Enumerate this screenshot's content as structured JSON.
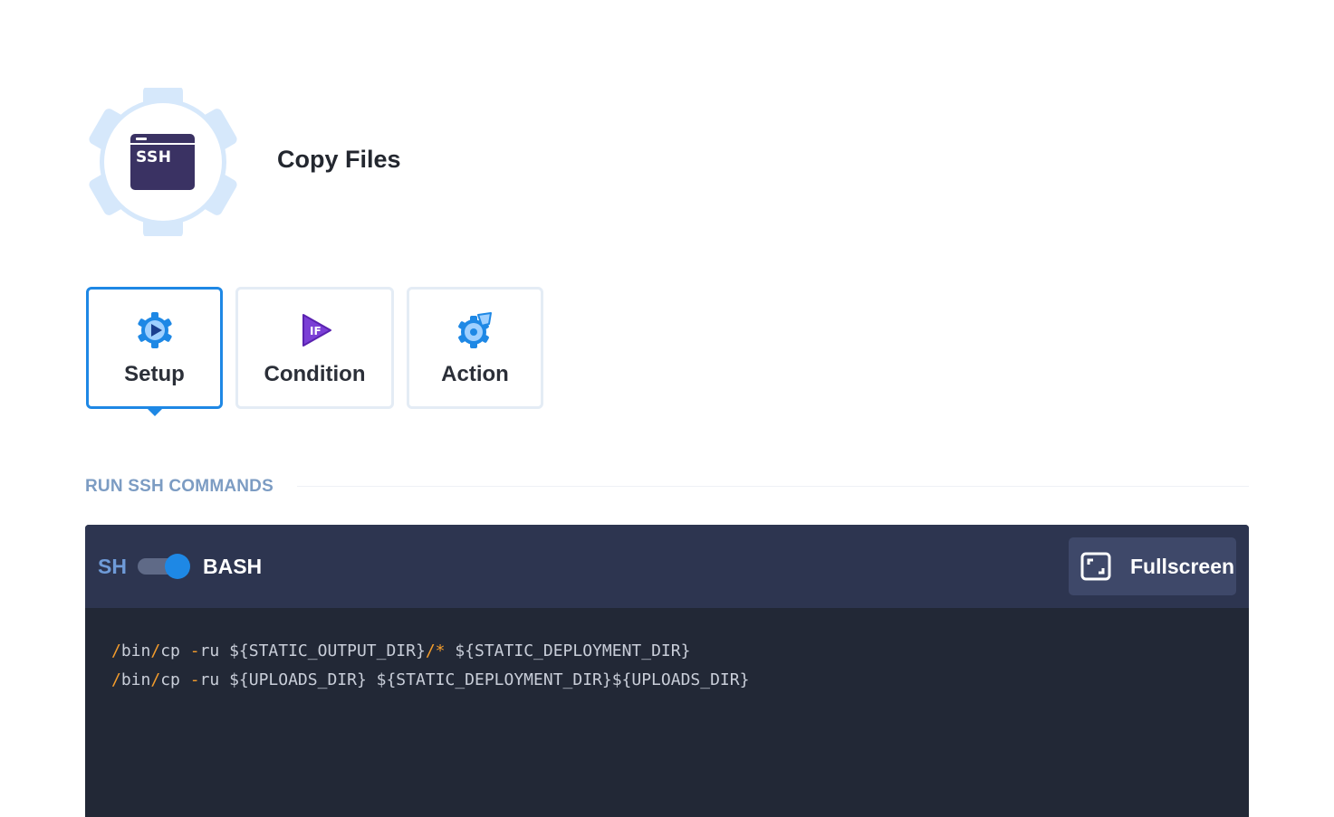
{
  "header": {
    "icon_text": "SSH",
    "title": "Copy Files"
  },
  "tabs": [
    {
      "label": "Setup",
      "icon": "setup-gear-play-icon",
      "active": true
    },
    {
      "label": "Condition",
      "icon": "condition-if-icon",
      "active": false
    },
    {
      "label": "Action",
      "icon": "action-gear-hand-icon",
      "active": false
    }
  ],
  "section": {
    "title": "RUN SSH COMMANDS"
  },
  "editor": {
    "shell_left_label": "SH",
    "shell_right_label": "BASH",
    "toggle_on": true,
    "fullscreen_label": "Fullscreen",
    "lines": [
      {
        "tokens": [
          {
            "t": "/",
            "k": "op"
          },
          {
            "t": "bin",
            "k": "txt"
          },
          {
            "t": "/",
            "k": "op"
          },
          {
            "t": "cp ",
            "k": "txt"
          },
          {
            "t": "-",
            "k": "op"
          },
          {
            "t": "ru ${STATIC_OUTPUT_DIR}",
            "k": "txt"
          },
          {
            "t": "/*",
            "k": "op"
          },
          {
            "t": " ${STATIC_DEPLOYMENT_DIR}",
            "k": "txt"
          }
        ]
      },
      {
        "tokens": [
          {
            "t": "/",
            "k": "op"
          },
          {
            "t": "bin",
            "k": "txt"
          },
          {
            "t": "/",
            "k": "op"
          },
          {
            "t": "cp ",
            "k": "txt"
          },
          {
            "t": "-",
            "k": "op"
          },
          {
            "t": "ru ${UPLOADS_DIR} ${STATIC_DEPLOYMENT_DIR}${UPLOADS_DIR}",
            "k": "txt"
          }
        ]
      }
    ]
  },
  "colors": {
    "accent": "#1e88e5",
    "editor_bg": "#222836",
    "toolbar_bg": "#2d3550",
    "operator": "#f39c2c",
    "section_title": "#7c9cc3"
  }
}
